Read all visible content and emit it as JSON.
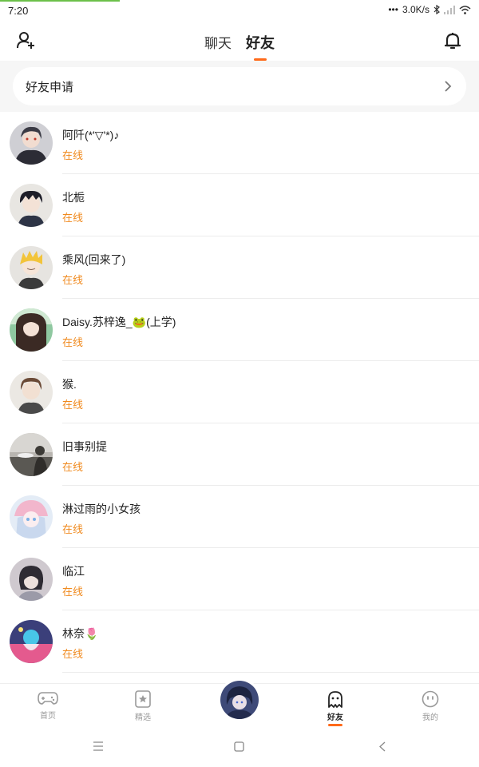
{
  "status_bar": {
    "time": "7:20",
    "network_speed": "3.0K/s",
    "page_load_progress": 0.25
  },
  "header": {
    "tabs": [
      {
        "label": "聊天",
        "active": false
      },
      {
        "label": "好友",
        "active": true
      }
    ],
    "left_icon": "add-friend-icon",
    "right_icon": "bell-icon"
  },
  "friend_request": {
    "label": "好友申请"
  },
  "friends": [
    {
      "name": "阿阡(*'▽'*)♪",
      "status": "在线"
    },
    {
      "name": "北栀",
      "status": "在线"
    },
    {
      "name": "乘风(回来了)",
      "status": "在线"
    },
    {
      "name": "Daisy.苏梓逸_🐸(上学)",
      "status": "在线"
    },
    {
      "name": "猴.",
      "status": "在线"
    },
    {
      "name": "旧事别提",
      "status": "在线"
    },
    {
      "name": "淋过雨的小女孩",
      "status": "在线"
    },
    {
      "name": "临江",
      "status": "在线"
    },
    {
      "name": "林奈🌷",
      "status": "在线"
    }
  ],
  "bottom_nav": {
    "items": [
      {
        "label": "首页",
        "icon": "gamepad-icon",
        "active": false
      },
      {
        "label": "精选",
        "icon": "star-card-icon",
        "active": false
      },
      {
        "label": "",
        "icon": "user-avatar",
        "active": false
      },
      {
        "label": "好友",
        "icon": "ghost-icon",
        "active": true
      },
      {
        "label": "我的",
        "icon": "face-icon",
        "active": false
      }
    ]
  },
  "colors": {
    "accent": "#ff6a1a",
    "online": "#f08a1e",
    "background_band": "#f6f6f6",
    "divider": "#ececec"
  }
}
